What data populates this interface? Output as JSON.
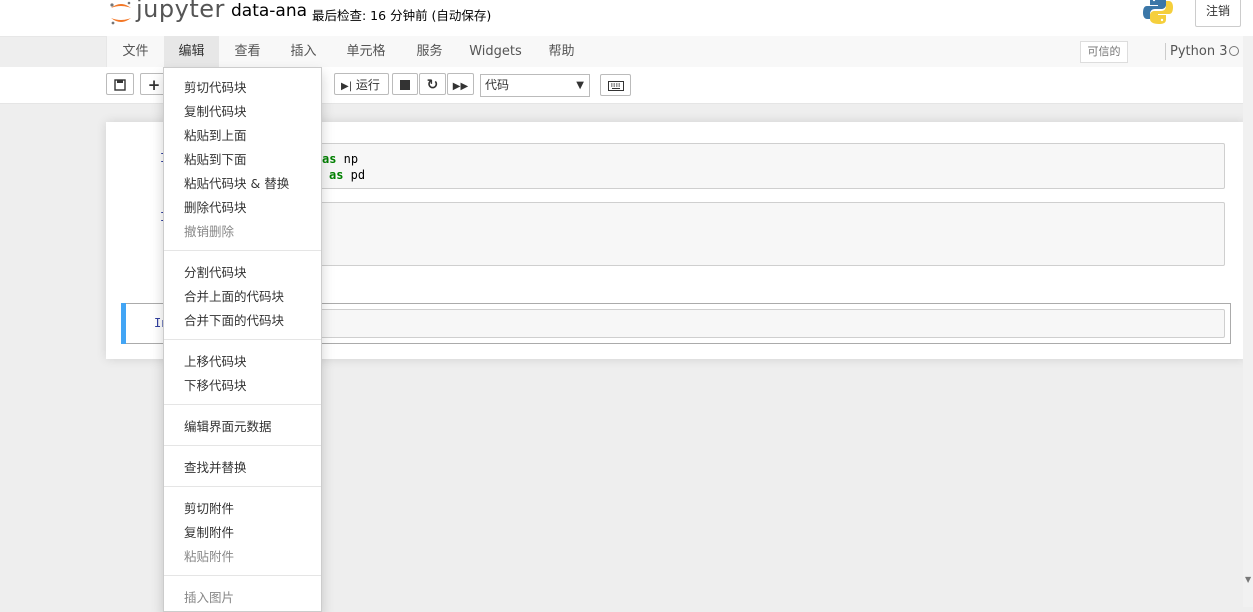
{
  "header": {
    "logo_text": "jupyter",
    "notebook_name": "data-ana",
    "checkpoint": "最后检查: 16 分钟前  (自动保存)",
    "logout_label": "注销"
  },
  "menubar": {
    "items": [
      "文件",
      "编辑",
      "查看",
      "插入",
      "单元格",
      "服务",
      "Widgets",
      "帮助"
    ],
    "trusted_label": "可信的",
    "kernel_name": "Python 3"
  },
  "toolbar": {
    "run_label": "运行",
    "cell_type": "代码"
  },
  "cells": {
    "c1": {
      "prompt": "I",
      "line1_kw": "as",
      "line1_rest": " np",
      "line2_kw": "as",
      "line2_rest": " pd"
    },
    "c2": {
      "prompt": "I"
    },
    "c3": {
      "prompt": "In"
    }
  },
  "edit_menu": {
    "items": [
      "剪切代码块",
      "复制代码块",
      "粘贴到上面",
      "粘贴到下面",
      "粘贴代码块 & 替换",
      "删除代码块",
      "撤销删除",
      "分割代码块",
      "合并上面的代码块",
      "合并下面的代码块",
      "上移代码块",
      "下移代码块",
      "编辑界面元数据",
      "查找并替换",
      "剪切附件",
      "复制附件",
      "粘贴附件",
      "插入图片"
    ]
  },
  "icons": {
    "save": "save-icon",
    "add": "plus-icon",
    "run": "step-forward-icon",
    "stop": "stop-icon",
    "restart": "refresh-icon",
    "run_all": "fast-forward-icon",
    "keyboard": "keyboard-icon",
    "logo": "jupyter-logo-icon",
    "python": "python-logo-icon"
  },
  "colors": {
    "prompt": "#303f9f",
    "keyword": "#008000",
    "selected_bar": "#42a5f5",
    "logo_orange": "#f37726"
  }
}
